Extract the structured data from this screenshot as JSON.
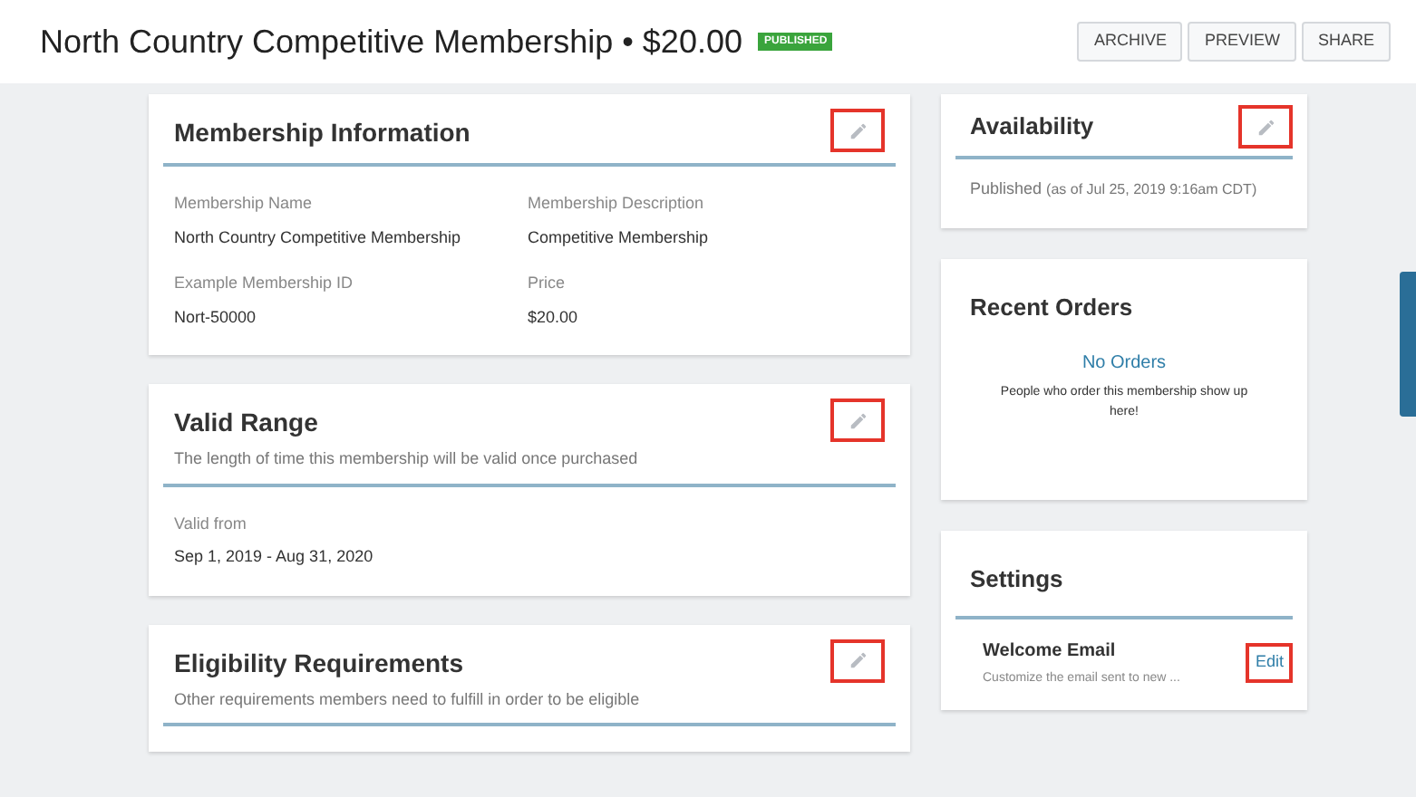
{
  "header": {
    "title": "North Country Competitive Membership • $20.00",
    "badge": "PUBLISHED",
    "buttons": [
      "ARCHIVE",
      "PREVIEW",
      "SHARE"
    ]
  },
  "left_cards": [
    {
      "title": "Membership Information",
      "edit": {
        "highlighted": true
      },
      "fields": [
        {
          "label": "Membership Name",
          "value": "North Country Competitive Membership"
        },
        {
          "label": "Membership Description",
          "value": "Competitive Membership"
        },
        {
          "label": "Example Membership ID",
          "value": "Nort-50000"
        },
        {
          "label": "Price",
          "value": "$20.00"
        }
      ]
    },
    {
      "title": "Valid Range",
      "subtitle": "The length of time this membership will be valid once purchased",
      "edit": {
        "highlighted": true
      },
      "fields": [
        {
          "label": "Valid from",
          "value": "Sep 1, 2019 - Aug 31, 2020"
        }
      ]
    },
    {
      "title": "Eligibility Requirements",
      "subtitle": "Other requirements members need to fulfill in order to be eligible",
      "edit": {
        "highlighted": true
      }
    }
  ],
  "availability": {
    "title": "Availability",
    "edit": {
      "highlighted": true
    },
    "status": "Published",
    "note": "(as of Jul 25, 2019 9:16am CDT)"
  },
  "recent_orders": {
    "title": "Recent Orders",
    "empty_title": "No Orders",
    "empty_text": "People who order this membership show up here!"
  },
  "settings": {
    "title": "Settings",
    "items": [
      {
        "name": "Welcome Email",
        "description": "Customize the email sent to new ...",
        "action": "Edit",
        "highlighted": true
      }
    ]
  }
}
